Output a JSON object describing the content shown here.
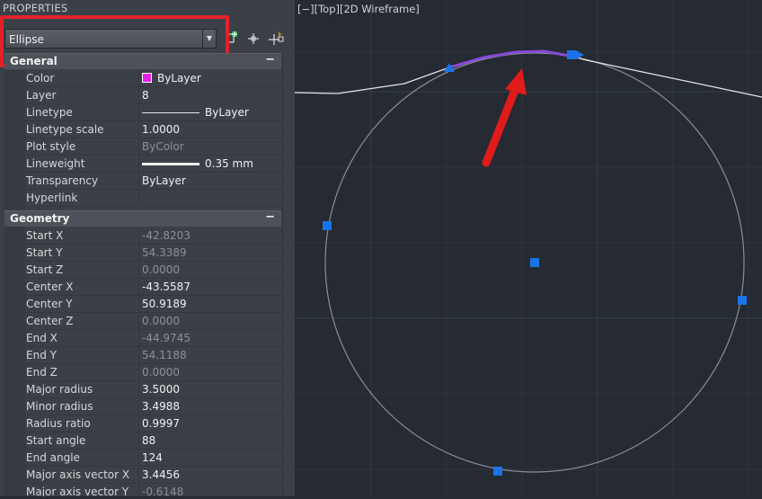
{
  "palette": {
    "title": "PROPERTIES",
    "selected_object": "Ellipse",
    "sections": {
      "general": {
        "title": "General",
        "toggle": "−",
        "rows": [
          {
            "name": "Color",
            "value": "ByLayer",
            "swatch_color": "#e61ee6"
          },
          {
            "name": "Layer",
            "value": "8"
          },
          {
            "name": "Linetype",
            "value": "ByLayer"
          },
          {
            "name": "Linetype scale",
            "value": "1.0000"
          },
          {
            "name": "Plot style",
            "value": "ByColor"
          },
          {
            "name": "Lineweight",
            "value": "0.35 mm"
          },
          {
            "name": "Transparency",
            "value": "ByLayer"
          },
          {
            "name": "Hyperlink",
            "value": ""
          }
        ]
      },
      "geometry": {
        "title": "Geometry",
        "toggle": "−",
        "rows": [
          {
            "name": "Start X",
            "value": "-42.8203"
          },
          {
            "name": "Start Y",
            "value": "54.3389"
          },
          {
            "name": "Start Z",
            "value": "0.0000"
          },
          {
            "name": "Center X",
            "value": "-43.5587"
          },
          {
            "name": "Center Y",
            "value": "50.9189"
          },
          {
            "name": "Center Z",
            "value": "0.0000"
          },
          {
            "name": "End X",
            "value": "-44.9745"
          },
          {
            "name": "End Y",
            "value": "54.1188"
          },
          {
            "name": "End Z",
            "value": "0.0000"
          },
          {
            "name": "Major radius",
            "value": "3.5000"
          },
          {
            "name": "Minor radius",
            "value": "3.4988"
          },
          {
            "name": "Radius ratio",
            "value": "0.9997"
          },
          {
            "name": "Start angle",
            "value": "88"
          },
          {
            "name": "End angle",
            "value": "124"
          },
          {
            "name": "Major axis vector X",
            "value": "3.4456"
          },
          {
            "name": "Major axis vector Y",
            "value": "-0.6148"
          }
        ]
      }
    }
  },
  "viewport": {
    "label": "[−][Top][2D Wireframe]",
    "colors": {
      "background": "#252a33",
      "grip": "#1a73e8",
      "arc_highlight": "#8a4ad8",
      "annotation_arrow": "#e01b1b"
    }
  }
}
